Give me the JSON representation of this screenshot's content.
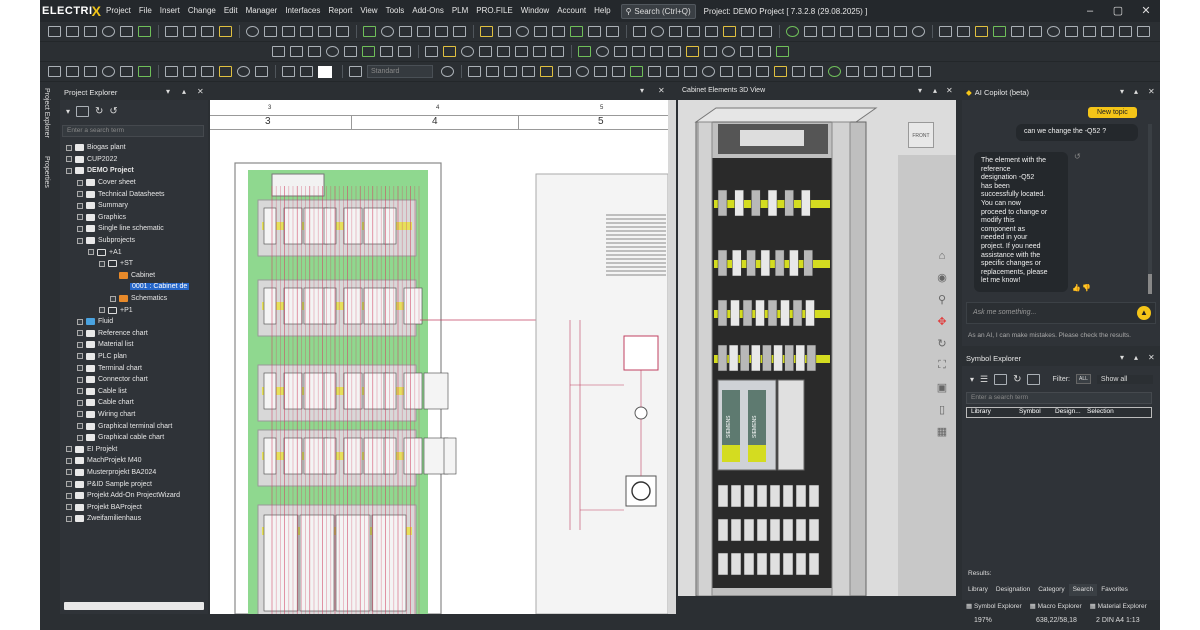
{
  "app": {
    "brand_text": "ELECTRI",
    "brand_x": "X",
    "menus": [
      "Project",
      "File",
      "Insert",
      "Change",
      "Edit",
      "Manager",
      "Interfaces",
      "Report",
      "View",
      "Tools",
      "Add-Ons",
      "PLM",
      "PRO.FILE",
      "Window",
      "Account",
      "Help"
    ],
    "search_label": "Search (Ctrl+Q)",
    "window_title": "Project: DEMO Project  [ 7.3.2.8 (29.08.2025) ]"
  },
  "toolbar": {
    "line_style": "Standard"
  },
  "side_tabs": [
    "Project Explorer",
    "Properties"
  ],
  "project_explorer": {
    "title": "Project Explorer",
    "search_placeholder": "Enter a search term",
    "items": [
      {
        "label": "Biogas plant",
        "indent": 0,
        "icon": "folder",
        "exp": true
      },
      {
        "label": "CUP2022",
        "indent": 0,
        "icon": "folder",
        "exp": true
      },
      {
        "label": "DEMO Project",
        "indent": 0,
        "icon": "folder",
        "exp": true,
        "bold": true
      },
      {
        "label": "Cover sheet",
        "indent": 1,
        "icon": "page",
        "exp": true
      },
      {
        "label": "Technical Datasheets",
        "indent": 1,
        "icon": "page",
        "exp": true
      },
      {
        "label": "Summary",
        "indent": 1,
        "icon": "page",
        "exp": true
      },
      {
        "label": "Graphics",
        "indent": 1,
        "icon": "page",
        "exp": true
      },
      {
        "label": "Single line schematic",
        "indent": 1,
        "icon": "page",
        "exp": true
      },
      {
        "label": "Subprojects",
        "indent": 1,
        "icon": "folder",
        "exp": true
      },
      {
        "label": "+A1",
        "indent": 2,
        "icon": "outline",
        "exp": true
      },
      {
        "label": "+ST",
        "indent": 3,
        "icon": "outline",
        "exp": true
      },
      {
        "label": "Cabinet",
        "indent": 4,
        "icon": "folder-o",
        "exp": false
      },
      {
        "label": "0001 : Cabinet de",
        "indent": 5,
        "icon": "none",
        "exp": false,
        "selected": true
      },
      {
        "label": "Schematics",
        "indent": 4,
        "icon": "folder-o",
        "exp": true
      },
      {
        "label": "+P1",
        "indent": 3,
        "icon": "outline",
        "exp": true
      },
      {
        "label": "Fluid",
        "indent": 1,
        "icon": "blue",
        "exp": true
      },
      {
        "label": "Reference chart",
        "indent": 1,
        "icon": "page",
        "exp": true
      },
      {
        "label": "Material list",
        "indent": 1,
        "icon": "page",
        "exp": true
      },
      {
        "label": "PLC plan",
        "indent": 1,
        "icon": "page",
        "exp": true
      },
      {
        "label": "Terminal chart",
        "indent": 1,
        "icon": "page",
        "exp": true
      },
      {
        "label": "Connector chart",
        "indent": 1,
        "icon": "page",
        "exp": true
      },
      {
        "label": "Cable list",
        "indent": 1,
        "icon": "page",
        "exp": true
      },
      {
        "label": "Cable chart",
        "indent": 1,
        "icon": "page",
        "exp": true
      },
      {
        "label": "Wiring chart",
        "indent": 1,
        "icon": "page",
        "exp": true
      },
      {
        "label": "Graphical terminal chart",
        "indent": 1,
        "icon": "page",
        "exp": true
      },
      {
        "label": "Graphical cable chart",
        "indent": 1,
        "icon": "page",
        "exp": true
      },
      {
        "label": "EI Projekt",
        "indent": 0,
        "icon": "folder",
        "exp": true
      },
      {
        "label": "MachProjekt M40",
        "indent": 0,
        "icon": "folder",
        "exp": true
      },
      {
        "label": "Musterprojekt BA2024",
        "indent": 0,
        "icon": "folder",
        "exp": true
      },
      {
        "label": "P&ID Sample project",
        "indent": 0,
        "icon": "folder",
        "exp": true
      },
      {
        "label": "Projekt Add-On ProjectWizard",
        "indent": 0,
        "icon": "folder",
        "exp": true
      },
      {
        "label": "Projekt BAProject",
        "indent": 0,
        "icon": "folder",
        "exp": true
      },
      {
        "label": "Zweifamilienhaus",
        "indent": 0,
        "icon": "folder",
        "exp": true
      }
    ]
  },
  "schematic": {
    "ruler_top": [
      "3",
      "4",
      "5"
    ],
    "ruler_main": [
      "3",
      "4",
      "5"
    ]
  },
  "view3d": {
    "title": "Cabinet Elements 3D View",
    "cube_label": "FRONT",
    "brand_label": "SIEMENS"
  },
  "copilot": {
    "title": "AI Copilot (beta)",
    "new_topic": "New topic",
    "user_message": "can we change the -Q52 ?",
    "ai_message_lines": [
      "The element with the",
      "reference",
      "designation -Q52",
      "has been",
      "successfully located.",
      "You can now",
      "proceed to change or",
      "modify this",
      "component as",
      "needed in your",
      "project. If you need",
      "assistance with the",
      "specific changes or",
      "replacements, please",
      "let me know!"
    ],
    "input_placeholder": "Ask me something...",
    "disclaimer": "As an AI, I can make mistakes. Please check the results."
  },
  "symbol_explorer": {
    "title": "Symbol Explorer",
    "filter_label": "Filter:",
    "filter_all": "ALL",
    "filter_value": "Show all",
    "search_placeholder": "Enter a search term",
    "columns": [
      "Library",
      "Symbol",
      "Design...",
      "Selection"
    ],
    "results_label": "Results:",
    "tabs": [
      "Library",
      "Designation",
      "Category",
      "Search",
      "Favorites"
    ],
    "explorer_tabs": [
      "Symbol Explorer",
      "Macro Explorer",
      "Material Explorer"
    ]
  },
  "status": {
    "zoom": "197%",
    "coords": "638,22/58,18",
    "sheet": "2  DIN A4  1:13"
  }
}
